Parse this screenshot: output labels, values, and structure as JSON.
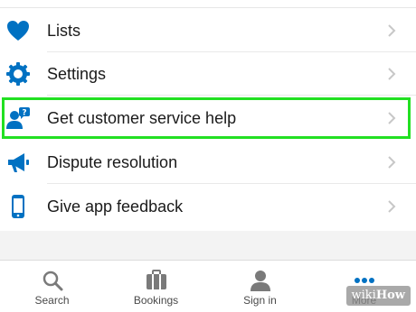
{
  "menu": {
    "items": [
      {
        "label": "Lists",
        "icon": "heart-icon"
      },
      {
        "label": "Settings",
        "icon": "gear-icon"
      },
      {
        "label": "Get customer service help",
        "icon": "customer-service-icon"
      },
      {
        "label": "Dispute resolution",
        "icon": "megaphone-icon"
      },
      {
        "label": "Give app feedback",
        "icon": "phone-icon"
      }
    ],
    "highlighted_item": "Get customer service help"
  },
  "tabbar": {
    "tabs": [
      {
        "label": "Search",
        "icon": "search-icon"
      },
      {
        "label": "Bookings",
        "icon": "briefcase-icon"
      },
      {
        "label": "Sign in",
        "icon": "person-icon"
      },
      {
        "label": "More",
        "icon": "more-dots-icon"
      }
    ]
  },
  "watermark": {
    "wiki": "wiki",
    "how": "How"
  },
  "colors": {
    "accent": "#0071c2",
    "highlight": "#22e022",
    "chevron": "#c7c7c7",
    "tab_icon": "#7a7a7a"
  }
}
